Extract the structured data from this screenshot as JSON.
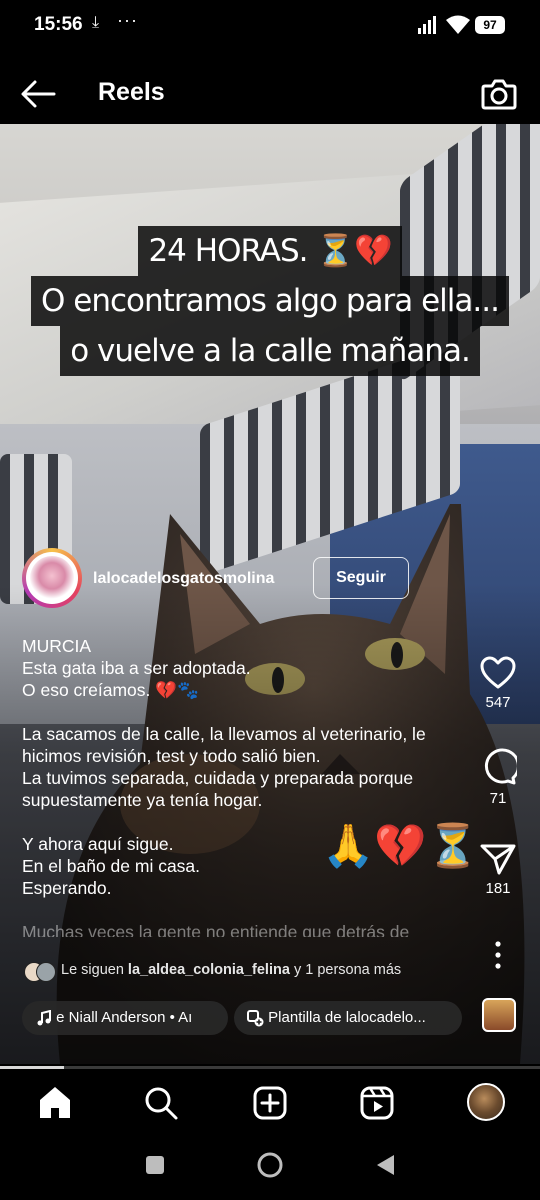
{
  "status_bar": {
    "time": "15:56",
    "battery": "97"
  },
  "header": {
    "title": "Reels"
  },
  "video": {
    "overlay_lines": [
      "24 HORAS. ⏳💔",
      "O encontramos algo para ella...",
      "o vuelve a la calle mañana."
    ],
    "decor_emoji": "🙏💔⏳"
  },
  "account": {
    "username": "lalocadelosgatosmolina",
    "follow_label": "Seguir"
  },
  "caption": {
    "lines": [
      "MURCIA",
      "Esta gata iba a ser adoptada.",
      "O eso creíamos. 💔🐾",
      "",
      "La sacamos de la calle, la llevamos al veterinario, le hicimos revisión, test y todo salió bien.",
      "La tuvimos separada, cuidada y preparada porque supuestamente ya tenía hogar.",
      "",
      "Y ahora aquí sigue.",
      "En el baño de mi casa.",
      "Esperando.",
      ""
    ],
    "faded_line": "Muchas veces la gente no entiende que detrás de"
  },
  "actions": {
    "likes": "547",
    "comments": "71",
    "shares": "181"
  },
  "followers": {
    "prefix": "Le siguen",
    "name": "la_aldea_colonia_felina",
    "suffix": "y 1 persona más"
  },
  "audio": {
    "music": "e   Niall Anderson • Aı",
    "template": "Plantilla de lalocadelo..."
  },
  "colors": {
    "background": "#000000",
    "follow_border": "#ffffff",
    "heart_red": "#c0392b"
  },
  "icons": [
    "back-arrow-icon",
    "camera-icon",
    "heart-icon",
    "comment-icon",
    "share-icon",
    "more-icon",
    "music-icon",
    "template-icon",
    "home-icon",
    "search-icon",
    "add-icon",
    "reels-icon"
  ]
}
